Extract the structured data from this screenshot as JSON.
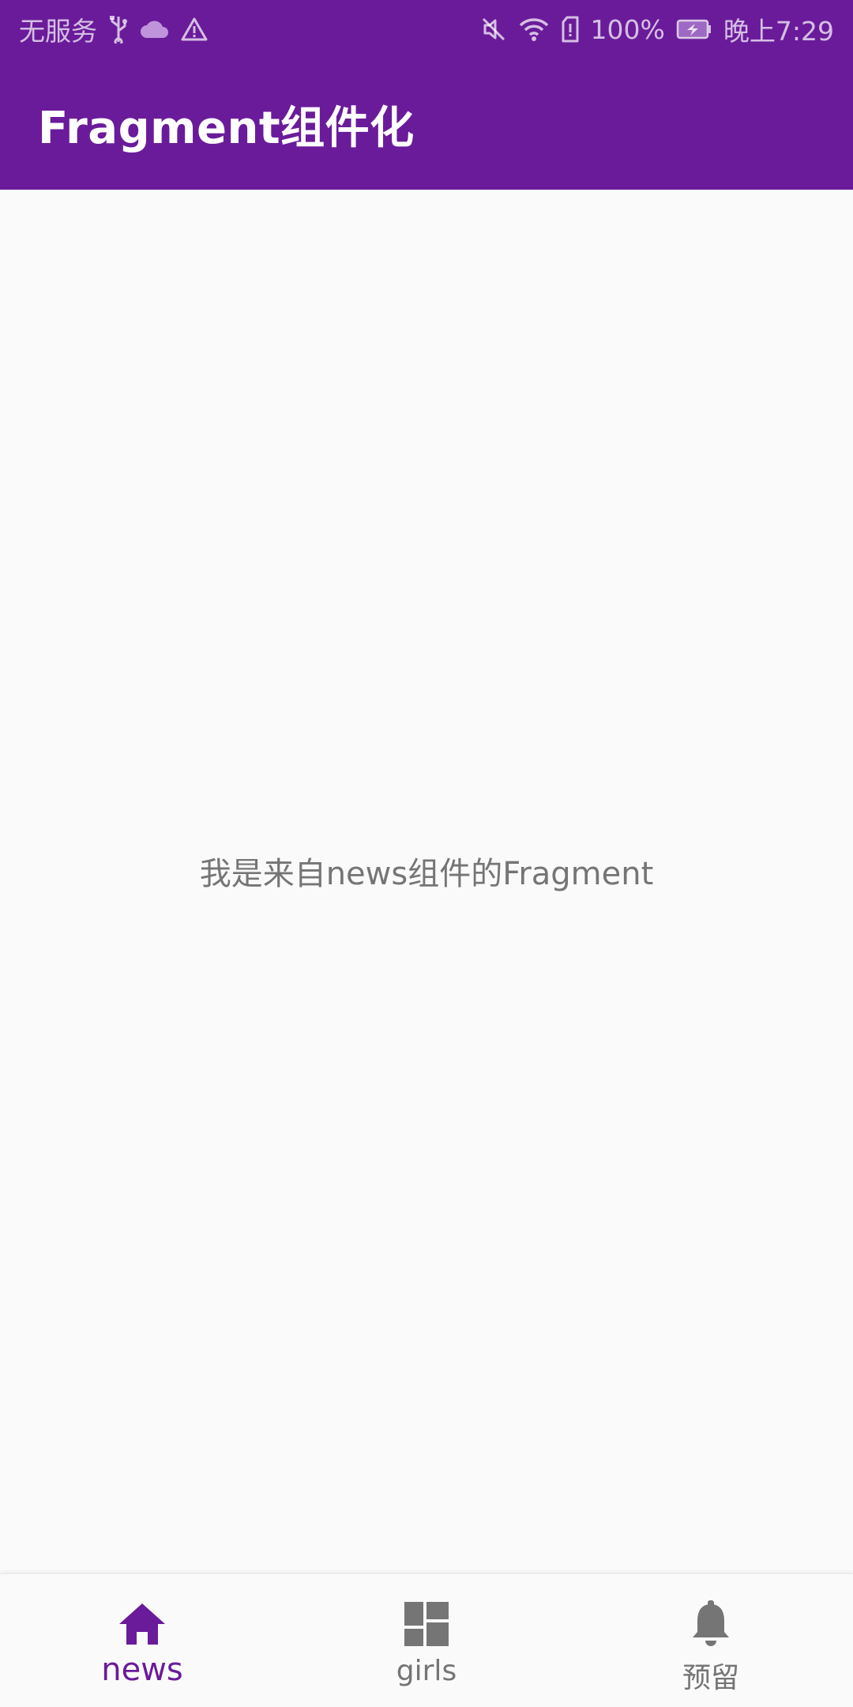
{
  "status_bar": {
    "carrier": "无服务",
    "battery_percent": "100%",
    "time": "晚上7:29",
    "icons_left": [
      "usb-icon",
      "cloud-icon",
      "warning-icon"
    ],
    "icons_right": [
      "mute-icon",
      "wifi-icon",
      "sim-icon",
      "battery-charging-icon"
    ]
  },
  "app_bar": {
    "title": "Fragment组件化"
  },
  "content": {
    "message": "我是来自news组件的Fragment"
  },
  "bottom_nav": {
    "items": [
      {
        "label": "news",
        "icon": "home-icon",
        "active": true
      },
      {
        "label": "girls",
        "icon": "dashboard-icon",
        "active": false
      },
      {
        "label": "预留",
        "icon": "bell-icon",
        "active": false
      }
    ]
  },
  "colors": {
    "primary": "#6a1b9a",
    "inactive": "#757575",
    "background": "#fafafa",
    "text_on_primary": "#ffffff"
  }
}
